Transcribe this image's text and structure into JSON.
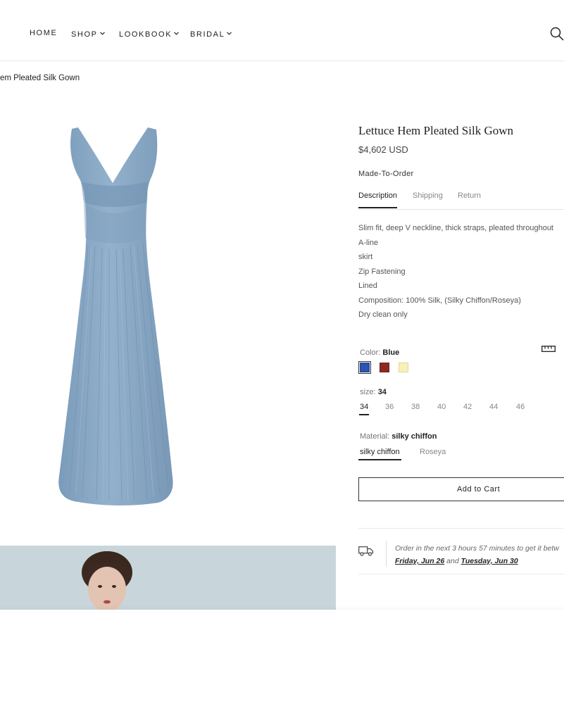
{
  "nav": {
    "items": [
      {
        "label": "HOME",
        "dropdown": false
      },
      {
        "label": "SHOP",
        "dropdown": true
      },
      {
        "label": "LOOKBOOK",
        "dropdown": true
      },
      {
        "label": "BRIDAL",
        "dropdown": true
      }
    ],
    "search_icon": "search-icon"
  },
  "breadcrumb": "em Pleated Silk Gown",
  "product": {
    "title": "Lettuce Hem Pleated Silk Gown",
    "price": "$4,602 USD",
    "made_to_order": "Made-To-Order",
    "tabs": [
      "Description",
      "Shipping",
      "Return"
    ],
    "active_tab": "Description",
    "description": [
      "Slim fit, deep V neckline, thick straps, pleated throughout",
      "A-line",
      "skirt",
      "Zip Fastening",
      "Lined",
      "Composition: 100% Silk, (Silky Chiffon/Roseya)",
      "Dry clean only"
    ],
    "color": {
      "label": "Color:",
      "selected": "Blue",
      "swatches": [
        {
          "name": "Blue",
          "hex": "#2a55b0"
        },
        {
          "name": "Red",
          "hex": "#8c2a22"
        },
        {
          "name": "Cream",
          "hex": "#f7f1b8"
        }
      ]
    },
    "size": {
      "label": "size:",
      "selected": "34",
      "options": [
        "34",
        "36",
        "38",
        "40",
        "42",
        "44",
        "46"
      ]
    },
    "material": {
      "label": "Material:",
      "selected": "silky chiffon",
      "options": [
        "silky chiffon",
        "Roseya"
      ]
    },
    "add_to_cart": "Add to Cart",
    "delivery": {
      "line1": "Order in the next 3 hours 57 minutes to get it betw",
      "date1": "Friday, Jun 26",
      "and": "and",
      "date2": "Tuesday, Jun 30",
      "icon": "truck-icon"
    }
  },
  "colors": {
    "dress": "#86a6c3",
    "text": "#222222",
    "muted": "#888888"
  }
}
